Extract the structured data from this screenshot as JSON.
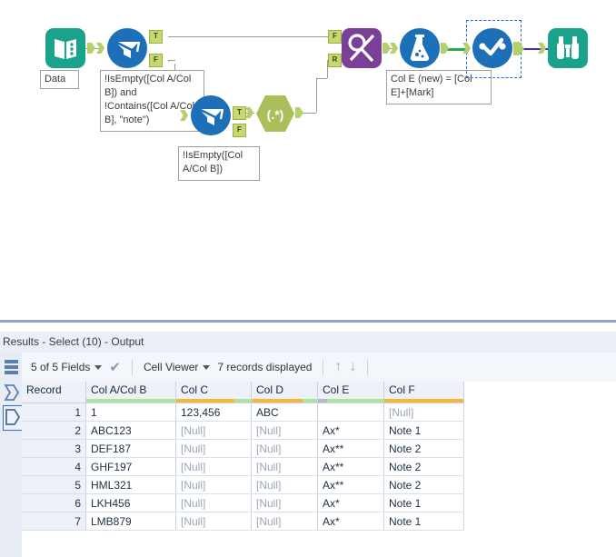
{
  "canvas": {
    "tools": [
      {
        "id": "input",
        "name": "input-data-tool",
        "icon": "book-icon",
        "color": "#1aa28a",
        "annotation": "Data"
      },
      {
        "id": "filter1",
        "name": "filter-tool-1",
        "icon": "filter-funnel-icon",
        "color": "#1d6fb8",
        "annotation": "!IsEmpty([Col A/Col B]) and !Contains([Col A/Col B], \"note\")",
        "out_labels": [
          "T",
          "F"
        ]
      },
      {
        "id": "filter2",
        "name": "filter-tool-2",
        "icon": "filter-funnel-icon",
        "color": "#1d6fb8",
        "annotation": "!IsEmpty([Col A/Col B])",
        "out_labels": [
          "T",
          "F"
        ]
      },
      {
        "id": "regex",
        "name": "regex-tool",
        "icon": "regex-icon",
        "color": "#a8bf5a",
        "glyph": "(.*)"
      },
      {
        "id": "union",
        "name": "union-tool",
        "icon": "union-icon",
        "color": "#7b3f98",
        "in_labels": [
          "F",
          "R"
        ]
      },
      {
        "id": "formula",
        "name": "formula-tool",
        "icon": "flask-icon",
        "color": "#1d6fb8",
        "annotation": "Col E (new) = [Col E]+[Mark]"
      },
      {
        "id": "select",
        "name": "select-tool",
        "icon": "select-check-icon",
        "color": "#1d6fb8",
        "selected": true
      },
      {
        "id": "browse",
        "name": "browse-tool",
        "icon": "binoculars-icon",
        "color": "#1aa28a"
      }
    ],
    "colors": {
      "teal": "#1aa28a",
      "blue": "#1d6fb8",
      "purple": "#7b3f98",
      "green_regex": "#a8bf5a",
      "anchor": "#c5d96e",
      "wire_gray": "#9a9a9a",
      "wire_green": "#2eaa4e",
      "wire_blue": "#3a2ed0",
      "selection": "#1f6fd0"
    }
  },
  "results": {
    "title": "Results - Select (10) - Output",
    "rail": [
      {
        "name": "table-view-icon",
        "label": "grid"
      },
      {
        "name": "input-anchor-icon",
        "label": "input"
      },
      {
        "name": "output-anchor-icon",
        "label": "output",
        "selected": true
      }
    ],
    "toolbar": {
      "fields_label": "5 of 5 Fields",
      "check_icon": "check-icon",
      "viewer_label": "Cell Viewer",
      "records_label": "7 records displayed",
      "up_icon": "arrow-up-icon",
      "down_icon": "arrow-down-icon"
    },
    "grid": {
      "columns": [
        "Record",
        "Col A/Col B",
        "Col C",
        "Col D",
        "Col E",
        "Col F"
      ],
      "quality_bars": [
        {
          "column": "Record",
          "segments": []
        },
        {
          "column": "Col A/Col B",
          "segments": [
            {
              "color": "#a8e6a0",
              "pct": 100
            }
          ]
        },
        {
          "column": "Col C",
          "segments": [
            {
              "color": "#f7b733",
              "pct": 78
            },
            {
              "color": "#a8e6a0",
              "pct": 22
            }
          ]
        },
        {
          "column": "Col D",
          "segments": [
            {
              "color": "#f7b733",
              "pct": 78
            },
            {
              "color": "#a8e6a0",
              "pct": 22
            }
          ]
        },
        {
          "column": "Col E",
          "segments": [
            {
              "color": "#b9b6c9",
              "pct": 14
            },
            {
              "color": "#a8e6a0",
              "pct": 86
            }
          ]
        },
        {
          "column": "Col F",
          "segments": [
            {
              "color": "#f7b733",
              "pct": 100
            }
          ]
        }
      ],
      "rows": [
        {
          "record": "1",
          "a_b": "1",
          "c": "123,456",
          "d": "ABC",
          "e": "",
          "f": "[Null]"
        },
        {
          "record": "2",
          "a_b": "ABC123",
          "c": "[Null]",
          "d": "[Null]",
          "e": "Ax*",
          "f": "Note 1"
        },
        {
          "record": "3",
          "a_b": "DEF187",
          "c": "[Null]",
          "d": "[Null]",
          "e": "Ax**",
          "f": "Note 2"
        },
        {
          "record": "4",
          "a_b": "GHF197",
          "c": "[Null]",
          "d": "[Null]",
          "e": "Ax**",
          "f": "Note 2"
        },
        {
          "record": "5",
          "a_b": "HML321",
          "c": "[Null]",
          "d": "[Null]",
          "e": "Ax**",
          "f": "Note 2"
        },
        {
          "record": "6",
          "a_b": "LKH456",
          "c": "[Null]",
          "d": "[Null]",
          "e": "Ax*",
          "f": "Note 1"
        },
        {
          "record": "7",
          "a_b": "LMB879",
          "c": "[Null]",
          "d": "[Null]",
          "e": "Ax*",
          "f": "Note 1"
        }
      ]
    }
  }
}
